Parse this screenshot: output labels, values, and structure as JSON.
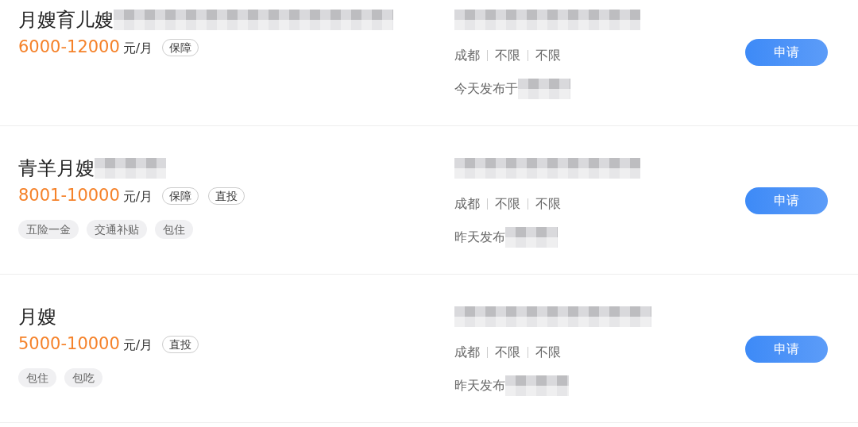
{
  "jobs": [
    {
      "title": "月嫂育儿嫂",
      "title_mosaic": true,
      "salary": "6000-12000",
      "unit": "元/月",
      "tags": [
        "保障"
      ],
      "location": [
        "成都",
        "不限",
        "不限"
      ],
      "posted": "今天发布于",
      "button": "申请"
    },
    {
      "title": "青羊月嫂",
      "title_mosaic": true,
      "salary": "8001-10000",
      "unit": "元/月",
      "tags": [
        "保障",
        "直投"
      ],
      "benefits": [
        "五险一金",
        "交通补贴",
        "包住"
      ],
      "location": [
        "成都",
        "不限",
        "不限"
      ],
      "posted": "昨天发布",
      "button": "申请"
    },
    {
      "title": "月嫂",
      "title_mosaic": false,
      "salary": "5000-10000",
      "unit": "元/月",
      "tags": [
        "直投"
      ],
      "benefits": [
        "包住",
        "包吃"
      ],
      "location": [
        "成都",
        "不限",
        "不限"
      ],
      "posted": "昨天发布",
      "button": "申请"
    }
  ]
}
